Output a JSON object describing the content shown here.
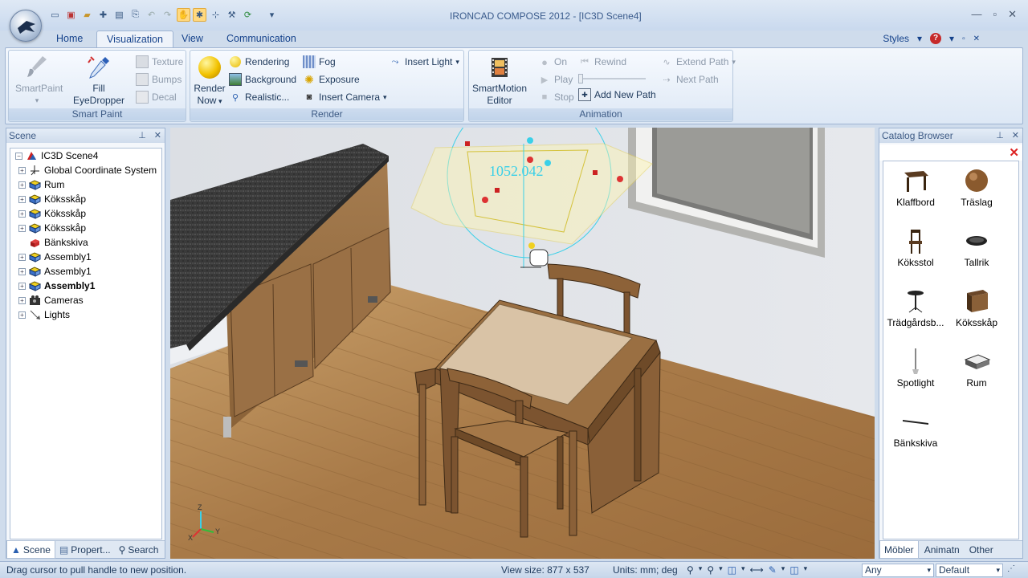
{
  "window": {
    "title": "IRONCAD COMPOSE 2012 - [IC3D Scene4]"
  },
  "ribbon_tabs": [
    "Home",
    "Visualization",
    "View",
    "Communication"
  ],
  "active_tab": "Visualization",
  "styles_label": "Styles",
  "groups": {
    "smart_paint": {
      "title": "Smart Paint",
      "smartpaint": "SmartPaint",
      "fill_1": "Fill",
      "fill_2": "EyeDropper",
      "texture": "Texture",
      "bumps": "Bumps",
      "decal": "Decal"
    },
    "render": {
      "title": "Render",
      "render_now_1": "Render",
      "render_now_2": "Now",
      "rendering": "Rendering",
      "background": "Background",
      "realistic": "Realistic...",
      "fog": "Fog",
      "exposure": "Exposure",
      "insert_camera": "Insert Camera",
      "insert_light": "Insert Light"
    },
    "animation": {
      "title": "Animation",
      "editor_1": "SmartMotion",
      "editor_2": "Editor",
      "on": "On",
      "play": "Play",
      "stop": "Stop",
      "rewind": "Rewind",
      "add_new_path": "Add New Path",
      "extend_path": "Extend Path",
      "next_path": "Next Path"
    }
  },
  "scene_panel": {
    "title": "Scene",
    "tree": [
      {
        "label": "IC3D Scene4",
        "icon": "scene-root-icon",
        "bold": false
      },
      {
        "label": "Global Coordinate System",
        "icon": "axes-icon",
        "bold": false
      },
      {
        "label": "Rum",
        "icon": "assembly-icon",
        "bold": false
      },
      {
        "label": "Köksskåp",
        "icon": "assembly-icon",
        "bold": false
      },
      {
        "label": "Köksskåp",
        "icon": "assembly-icon",
        "bold": false
      },
      {
        "label": "Köksskåp",
        "icon": "assembly-icon",
        "bold": false
      },
      {
        "label": "Bänkskiva",
        "icon": "part-icon",
        "bold": false
      },
      {
        "label": "Assembly1",
        "icon": "assembly-icon",
        "bold": false
      },
      {
        "label": "Assembly1",
        "icon": "assembly-icon",
        "bold": false
      },
      {
        "label": "Assembly1",
        "icon": "assembly-icon",
        "bold": true
      },
      {
        "label": "Cameras",
        "icon": "camera-icon",
        "bold": false
      },
      {
        "label": "Lights",
        "icon": "light-icon",
        "bold": false
      }
    ],
    "tabs": [
      "Scene",
      "Propert...",
      "Search"
    ]
  },
  "viewport": {
    "dimension_label": "1052.042",
    "axis_z": "Z",
    "axis_x": "X",
    "axis_y": "Y"
  },
  "catalog_panel": {
    "title": "Catalog Browser",
    "items": [
      "Klaffbord",
      "Träslag",
      "Köksstol",
      "Tallrik",
      "Trädgårdsb...",
      "Köksskåp",
      "Spotlight",
      "Rum",
      "Bänkskiva"
    ],
    "tabs": [
      "Möbler",
      "Animatn",
      "Other"
    ]
  },
  "status": {
    "message": "Drag cursor to pull handle to new position.",
    "view_size": "View size:  877 x  537",
    "units": "Units: mm; deg",
    "filter": "Any",
    "mode": "Default"
  }
}
